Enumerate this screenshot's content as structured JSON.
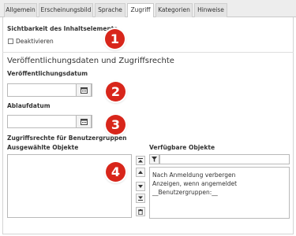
{
  "tabs": [
    {
      "label": "Allgemein"
    },
    {
      "label": "Erscheinungsbild"
    },
    {
      "label": "Sprache"
    },
    {
      "label": "Zugriff",
      "active": true
    },
    {
      "label": "Kategorien"
    },
    {
      "label": "Hinweise"
    }
  ],
  "visibility": {
    "title": "Sichtbarkeit des Inhaltselements",
    "checkbox_label": "Deaktivieren",
    "checked": false
  },
  "publish": {
    "section_title": "Veröffentlichungsdaten und Zugriffsrechte",
    "start_label": "Veröffentlichungsdatum",
    "start_value": "",
    "end_label": "Ablaufdatum",
    "end_value": ""
  },
  "access": {
    "title": "Zugriffsrechte für Benutzergruppen",
    "selected_label": "Ausgewählte Objekte",
    "available_label": "Verfügbare Objekte",
    "filter_value": "",
    "available_items": [
      "Nach Anmeldung verbergen",
      "Anzeigen, wenn angemeldet",
      "__Benutzergruppen:__"
    ]
  },
  "badges": [
    "1",
    "2",
    "3",
    "4"
  ],
  "colors": {
    "badge": "#d8261b",
    "tab_bg": "#ededed",
    "active_tab": "#ffffff"
  },
  "icons": {
    "date": "calendar-icon",
    "filter": "filter-icon"
  }
}
